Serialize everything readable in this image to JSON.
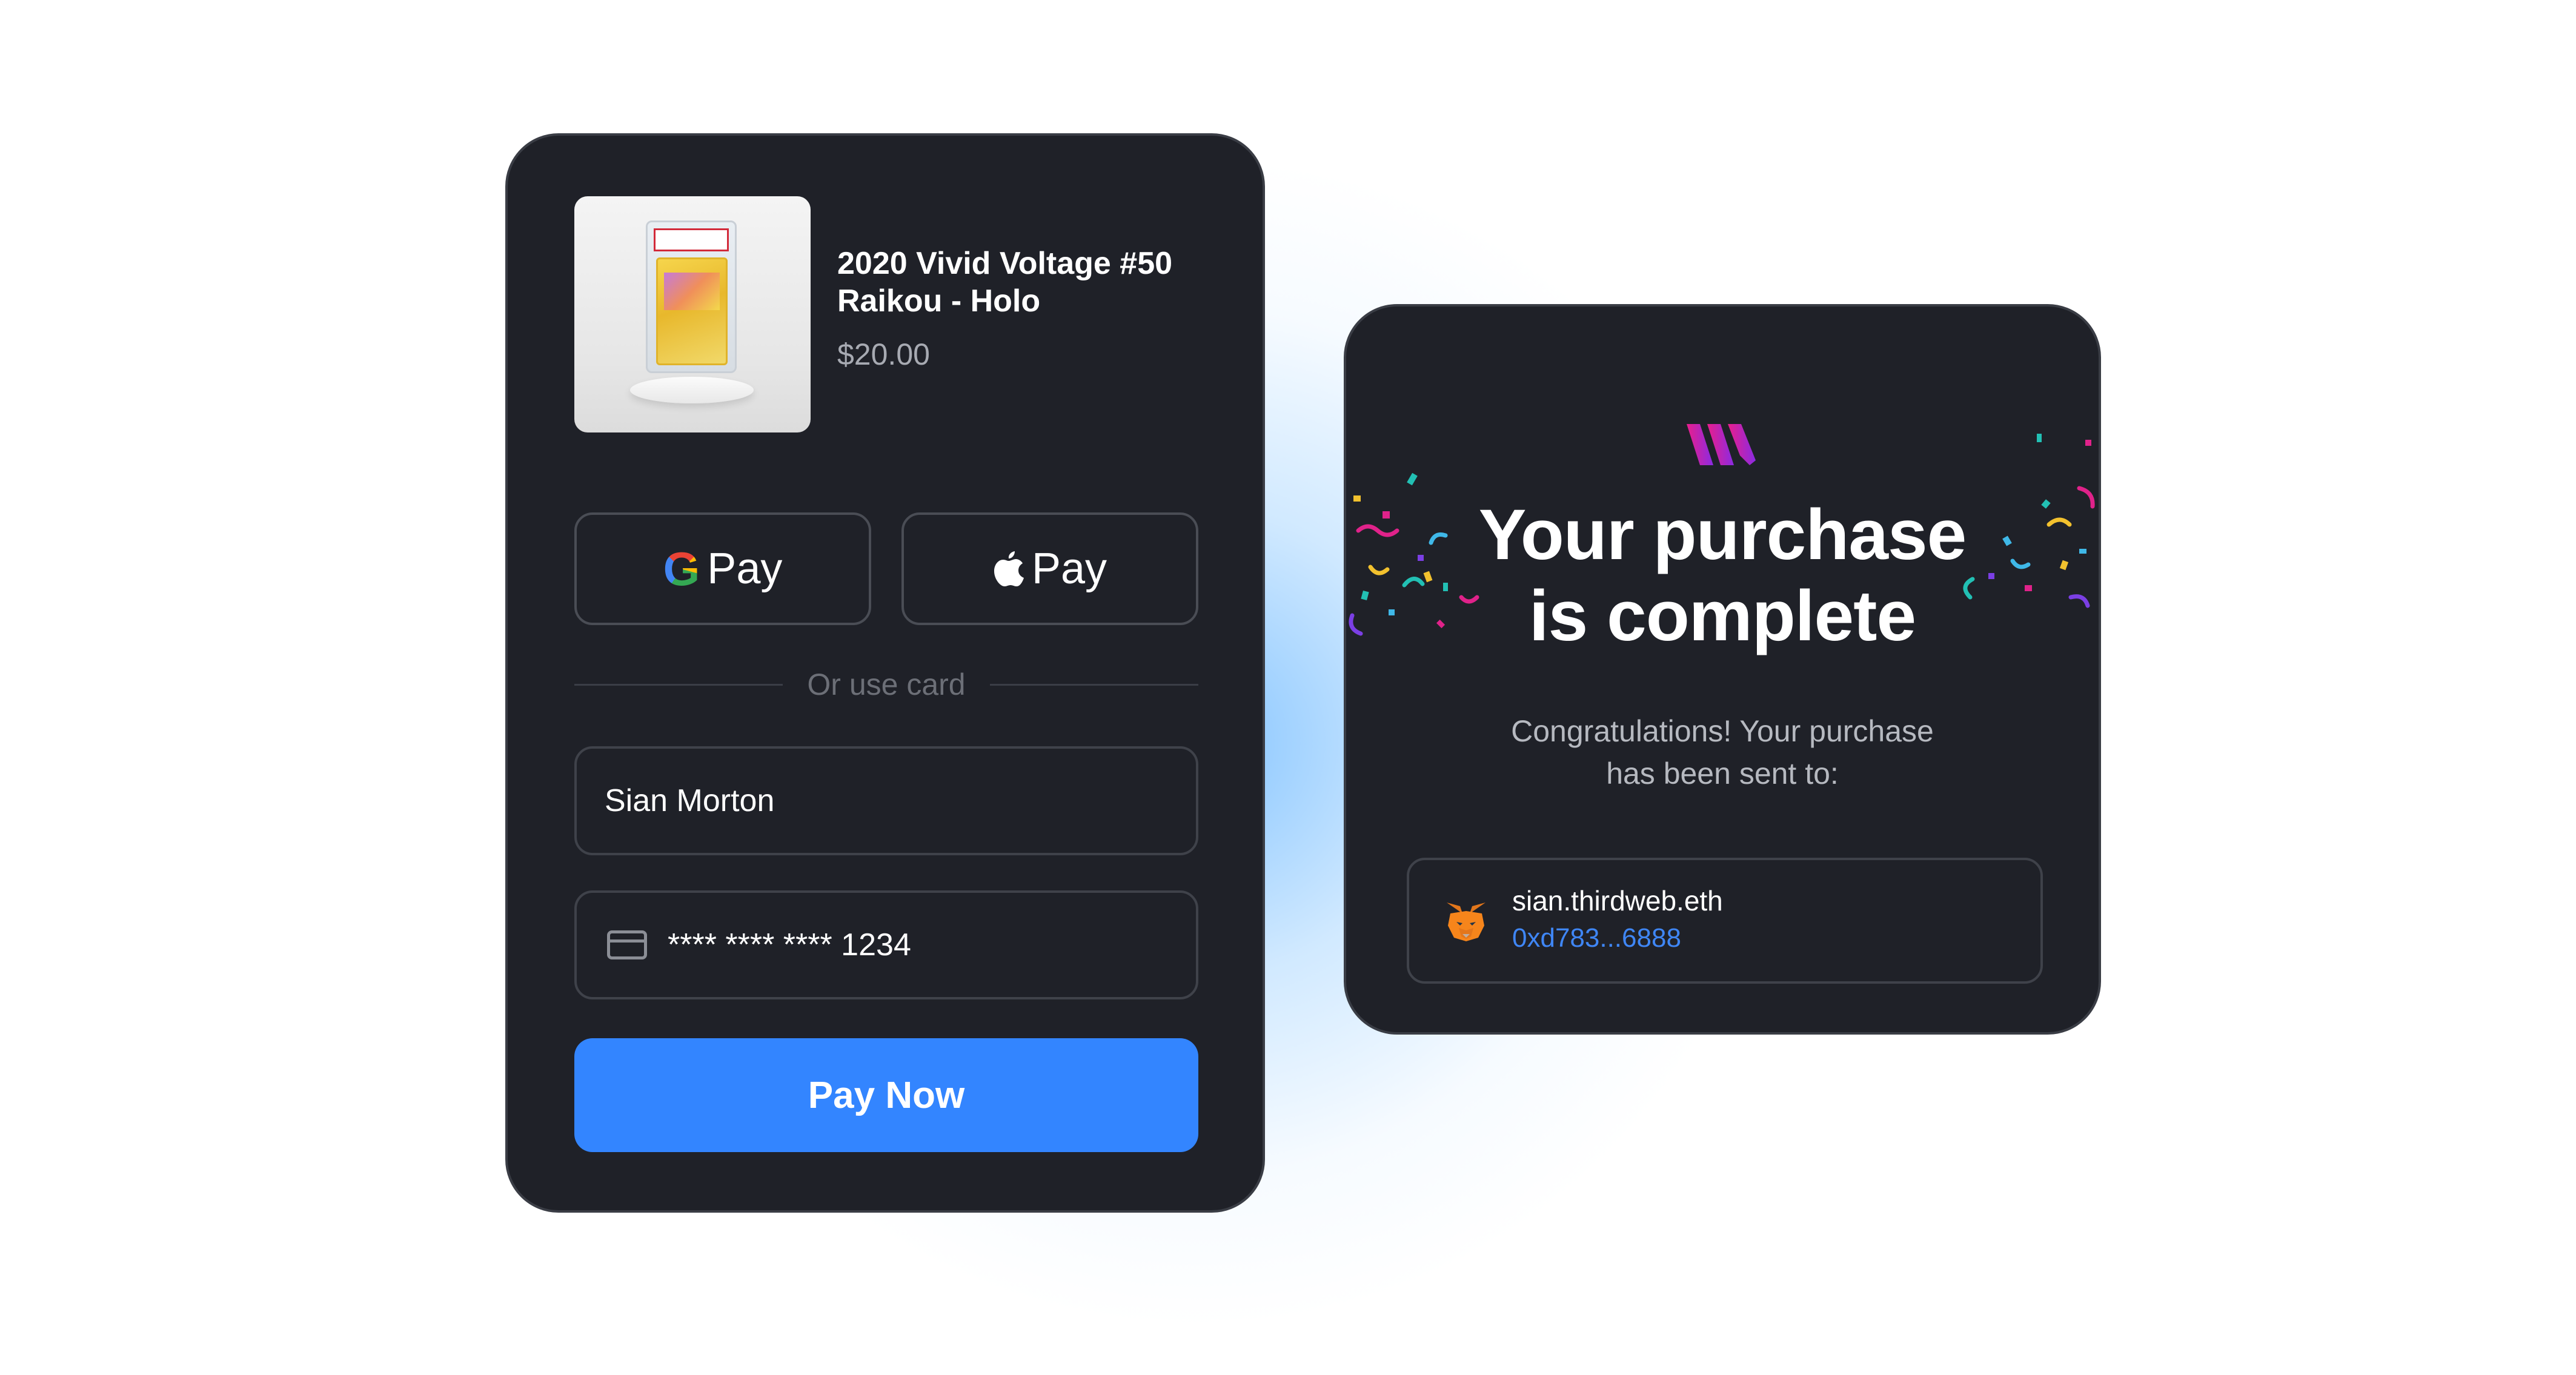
{
  "checkout": {
    "product": {
      "title": "2020 Vivid Voltage #50 Raikou - Holo",
      "price": "$20.00",
      "image_icon": "graded-card-image"
    },
    "wallet_buttons": [
      {
        "icon": "google-icon",
        "label": "Pay"
      },
      {
        "icon": "apple-icon",
        "label": "Pay"
      }
    ],
    "divider_text": "Or use card",
    "name_field": {
      "value": "Sian Morton"
    },
    "card_field": {
      "icon": "credit-card-icon",
      "value": "**** **** **** 1234"
    },
    "pay_button_label": "Pay Now"
  },
  "success": {
    "logo_icon": "brand-logo-icon",
    "title_line1": "Your purchase",
    "title_line2": "is complete",
    "message_line1": "Congratulations! Your purchase",
    "message_line2": "has been sent to:",
    "wallet": {
      "icon": "metamask-fox-icon",
      "name": "sian.thirdweb.eth",
      "address": "0xd783...6888"
    }
  },
  "colors": {
    "card_bg": "#1f2128",
    "accent_blue": "#3385ff",
    "address_link": "#3f86f5",
    "logo_gradient": [
      "#e91e8c",
      "#8a2be2"
    ]
  }
}
